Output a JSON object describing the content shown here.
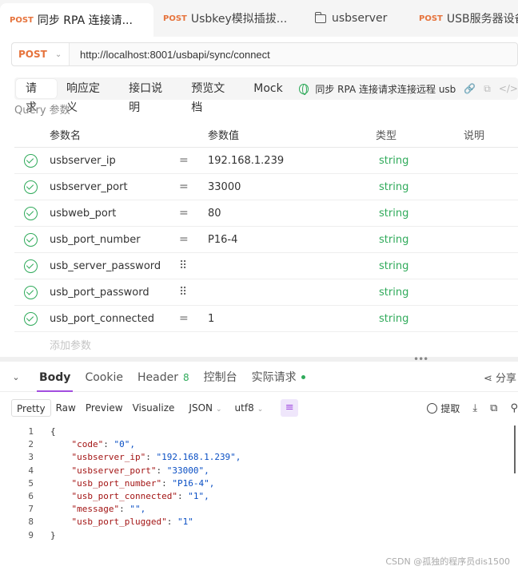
{
  "tabs": [
    {
      "method": "POST",
      "label": "同步 RPA 连接请..."
    },
    {
      "method": "POST",
      "label": "Usbkey模拟插拔..."
    },
    {
      "method": "",
      "label": "usbserver"
    },
    {
      "method": "POST",
      "label": "USB服务器设备"
    }
  ],
  "request": {
    "method": "POST",
    "url": "http://localhost:8001/usbapi/sync/connect"
  },
  "subtabs": [
    "请求",
    "响应定义",
    "接口说明",
    "预览文档",
    "Mock"
  ],
  "endpoint_desc": "同步 RPA 连接请求连接远程 usb",
  "query_label": "Query 参数",
  "param_headers": {
    "name": "参数名",
    "value": "参数值",
    "type": "类型",
    "note": "说明"
  },
  "params": [
    {
      "name": "usbserver_ip",
      "op": "=",
      "value": "192.168.1.239",
      "type": "string"
    },
    {
      "name": "usbserver_port",
      "op": "=",
      "value": "33000",
      "type": "string"
    },
    {
      "name": "usbweb_port",
      "op": "=",
      "value": "80",
      "type": "string"
    },
    {
      "name": "usb_port_number",
      "op": "=",
      "value": "P16-4",
      "type": "string"
    },
    {
      "name": "usb_server_password",
      "op": "⠿",
      "value": "",
      "type": "string"
    },
    {
      "name": "usb_port_password",
      "op": "⠿",
      "value": "",
      "type": "string"
    },
    {
      "name": "usb_port_connected",
      "op": "=",
      "value": "1",
      "type": "string"
    }
  ],
  "add_param": "添加参数",
  "response_tabs": {
    "body": "Body",
    "cookie": "Cookie",
    "header": "Header",
    "header_count": "8",
    "console": "控制台",
    "actual": "实际请求",
    "share": "分享"
  },
  "format_tabs": [
    "Pretty",
    "Raw",
    "Preview",
    "Visualize"
  ],
  "format_select": "JSON",
  "encoding_select": "utf8",
  "extract_label": "提取",
  "code_lines": [
    {
      "n": "1",
      "text": "{"
    },
    {
      "n": "2",
      "key": "\"code\"",
      "val": "\"0\","
    },
    {
      "n": "3",
      "key": "\"usbserver_ip\"",
      "val": "\"192.168.1.239\","
    },
    {
      "n": "4",
      "key": "\"usbserver_port\"",
      "val": "\"33000\","
    },
    {
      "n": "5",
      "key": "\"usb_port_number\"",
      "val": "\"P16-4\","
    },
    {
      "n": "6",
      "key": "\"usb_port_connected\"",
      "val": "\"1\","
    },
    {
      "n": "7",
      "key": "\"message\"",
      "val": "\"\","
    },
    {
      "n": "8",
      "key": "\"usb_port_plugged\"",
      "val": "\"1\""
    },
    {
      "n": "9",
      "text": "}"
    }
  ],
  "watermark": "CSDN @孤独的程序员dis1500",
  "colors": {
    "accent": "#a24ddf",
    "success": "#2faa5a",
    "method": "#e6733c"
  }
}
